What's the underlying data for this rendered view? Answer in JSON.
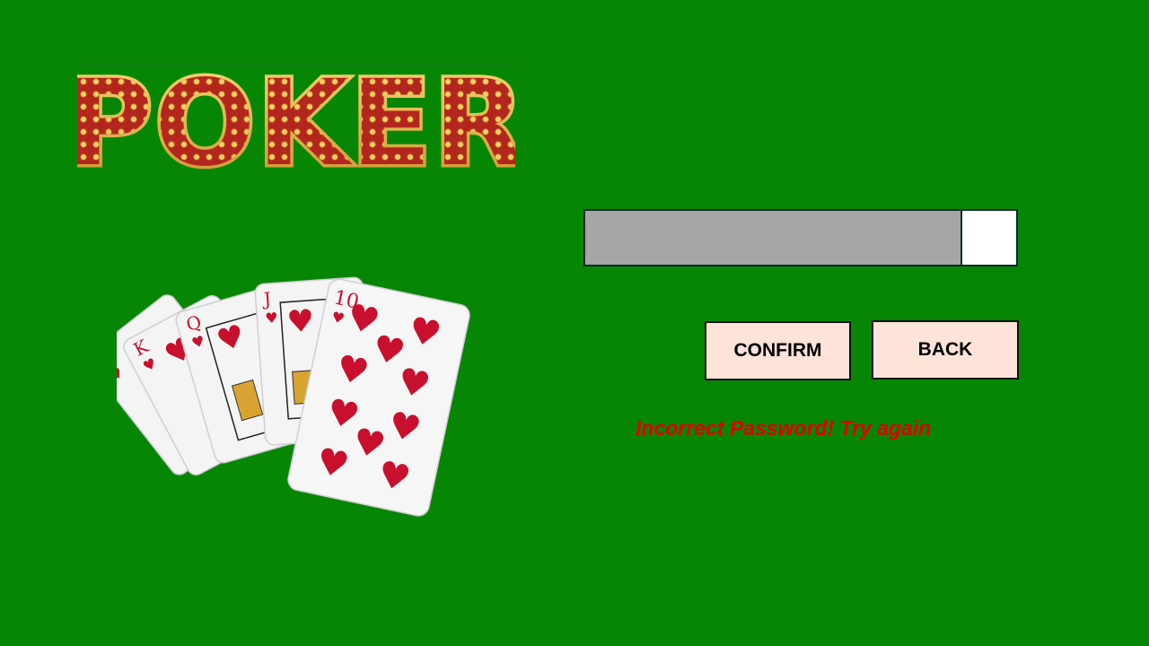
{
  "app": {
    "logo_text": "POKER",
    "background_color": "#078606"
  },
  "login": {
    "password_value": "",
    "confirm_label": "CONFIRM",
    "back_label": "BACK",
    "error_message": "Incorrect Password! Try again",
    "error_color": "#e00000",
    "button_color": "#fde3d8",
    "field_color": "#a6a6a6"
  },
  "cards": {
    "suit": "hearts",
    "ranks": [
      "A",
      "K",
      "Q",
      "J",
      "10"
    ],
    "icon": "royal-flush-cards-icon"
  }
}
